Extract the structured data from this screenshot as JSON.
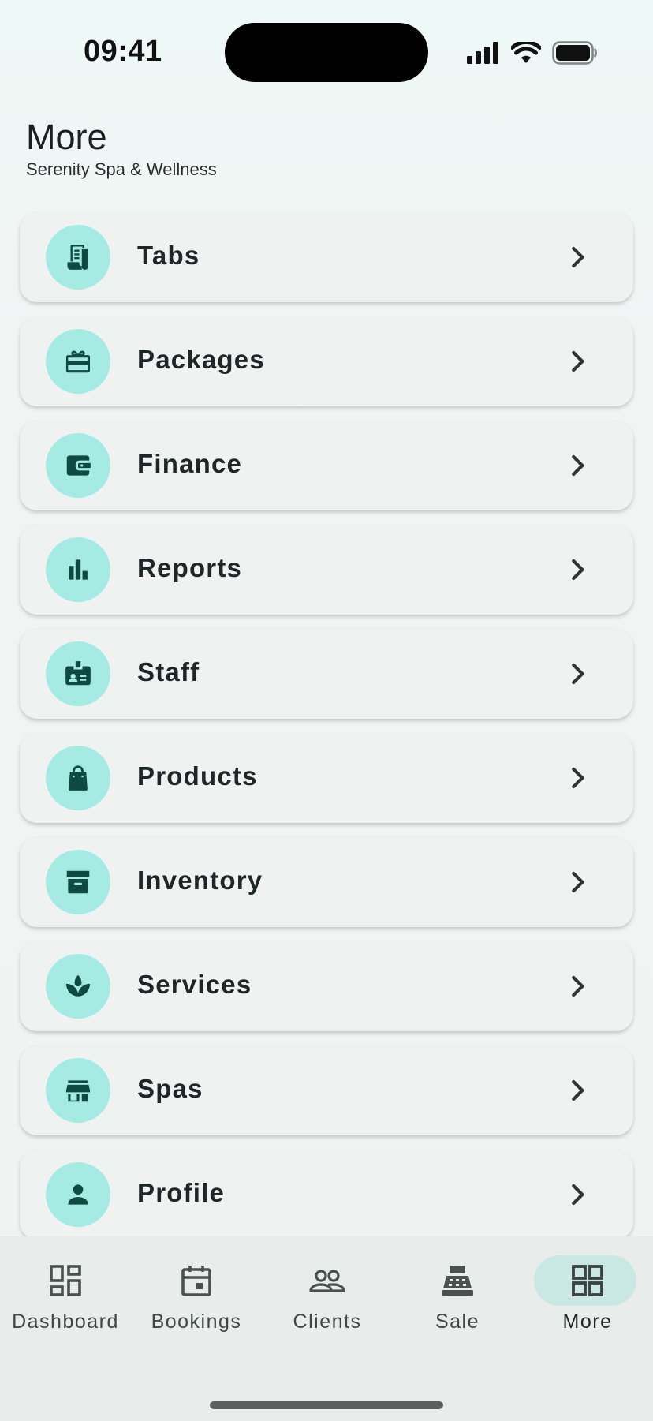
{
  "status_bar": {
    "time": "09:41"
  },
  "header": {
    "title": "More",
    "subtitle": "Serenity Spa & Wellness"
  },
  "menu": [
    {
      "label": "Tabs",
      "icon": "receipt-icon"
    },
    {
      "label": "Packages",
      "icon": "gift-card-icon"
    },
    {
      "label": "Finance",
      "icon": "wallet-icon"
    },
    {
      "label": "Reports",
      "icon": "bar-chart-icon"
    },
    {
      "label": "Staff",
      "icon": "badge-icon"
    },
    {
      "label": "Products",
      "icon": "shopping-bag-icon"
    },
    {
      "label": "Inventory",
      "icon": "archive-box-icon"
    },
    {
      "label": "Services",
      "icon": "spa-lotus-icon"
    },
    {
      "label": "Spas",
      "icon": "storefront-icon"
    },
    {
      "label": "Profile",
      "icon": "person-icon"
    }
  ],
  "bottom_nav": [
    {
      "label": "Dashboard",
      "icon": "dashboard-icon",
      "active": false
    },
    {
      "label": "Bookings",
      "icon": "calendar-icon",
      "active": false
    },
    {
      "label": "Clients",
      "icon": "people-icon",
      "active": false
    },
    {
      "label": "Sale",
      "icon": "cash-register-icon",
      "active": false
    },
    {
      "label": "More",
      "icon": "grid-icon",
      "active": true
    }
  ],
  "colors": {
    "accent": "#a6ebe3",
    "icon_dark": "#0f4a42",
    "active_pill": "#c9e8e3",
    "card": "#eff2f1"
  }
}
